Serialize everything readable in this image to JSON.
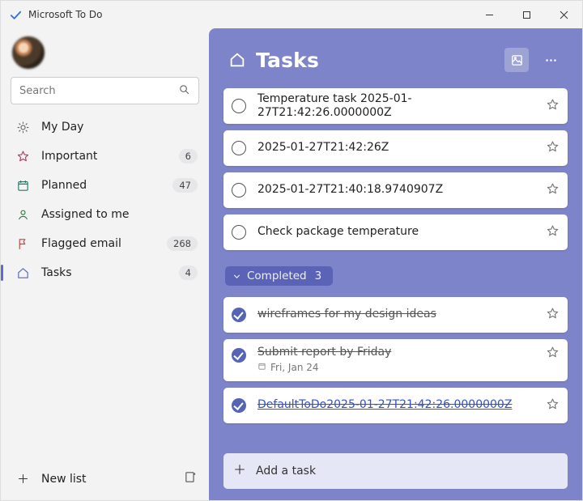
{
  "window": {
    "title": "Microsoft To Do"
  },
  "search": {
    "placeholder": "Search"
  },
  "sidebar": {
    "items": [
      {
        "id": "myday",
        "label": "My Day",
        "badge": ""
      },
      {
        "id": "important",
        "label": "Important",
        "badge": "6"
      },
      {
        "id": "planned",
        "label": "Planned",
        "badge": "47"
      },
      {
        "id": "assigned",
        "label": "Assigned to me",
        "badge": ""
      },
      {
        "id": "flagged",
        "label": "Flagged email",
        "badge": "268"
      },
      {
        "id": "tasks",
        "label": "Tasks",
        "badge": "4"
      }
    ],
    "newlist": "New list"
  },
  "main": {
    "title": "Tasks",
    "tasks": [
      {
        "label": "Temperature task 2025-01-27T21:42:26.0000000Z"
      },
      {
        "label": "2025-01-27T21:42:26Z"
      },
      {
        "label": "2025-01-27T21:40:18.9740907Z"
      },
      {
        "label": "Check package temperature"
      }
    ],
    "completed_label": "Completed",
    "completed_count": "3",
    "completed": [
      {
        "label": "wireframes for my design ideas",
        "due": ""
      },
      {
        "label": "Submit report by Friday",
        "due": "Fri, Jan 24"
      },
      {
        "label": "DefaultToDo2025-01-27T21:42:26.0000000Z",
        "due": ""
      }
    ],
    "addtask": "Add a task"
  }
}
